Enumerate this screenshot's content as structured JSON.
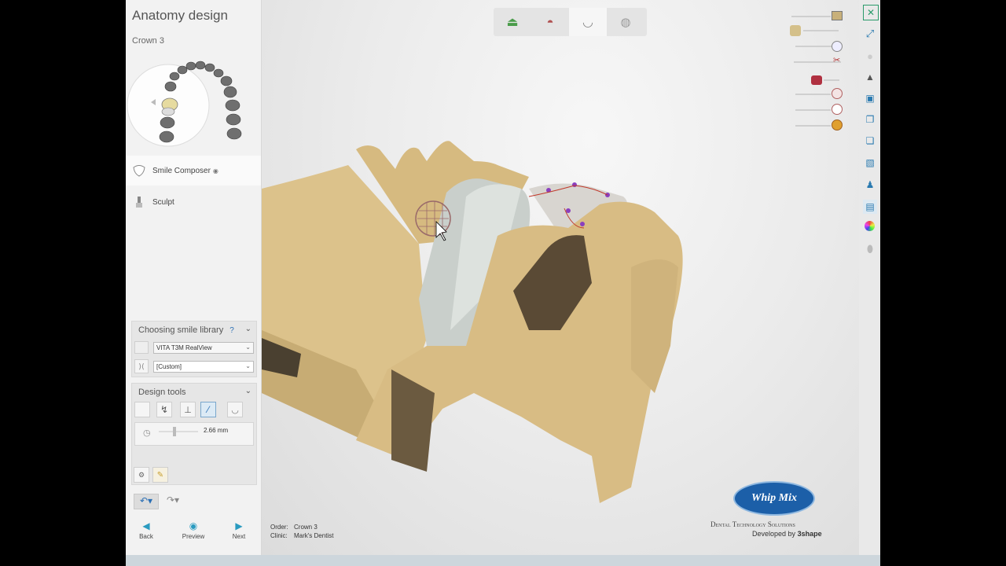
{
  "panel": {
    "title": "Anatomy design",
    "subtitle": "Crown 3"
  },
  "steps": [
    {
      "label": "Smile Composer",
      "icon": "tooth-icon"
    },
    {
      "label": "Sculpt",
      "icon": "sculpt-icon"
    }
  ],
  "smile_library": {
    "header": "Choosing smile library",
    "help": "?",
    "library_value": "VITA T3M RealView",
    "preset_value": "[Custom]"
  },
  "design_tools": {
    "header": "Design tools",
    "thickness_value": "2.66 mm"
  },
  "nav": {
    "back": "Back",
    "preview": "Preview",
    "next": "Next"
  },
  "order_info": {
    "order_label": "Order:",
    "order_value": "Crown 3",
    "clinic_label": "Clinic:",
    "clinic_value": "Mark's Dentist"
  },
  "brand": {
    "logo": "Whip Mix",
    "tagline": "Dental Technology Solutions",
    "developed_by": "Developed by",
    "developer": "3shape"
  },
  "colors": {
    "accent": "#2a9bc0",
    "model": "#d9c08c",
    "crown": "#c9cfcb"
  }
}
